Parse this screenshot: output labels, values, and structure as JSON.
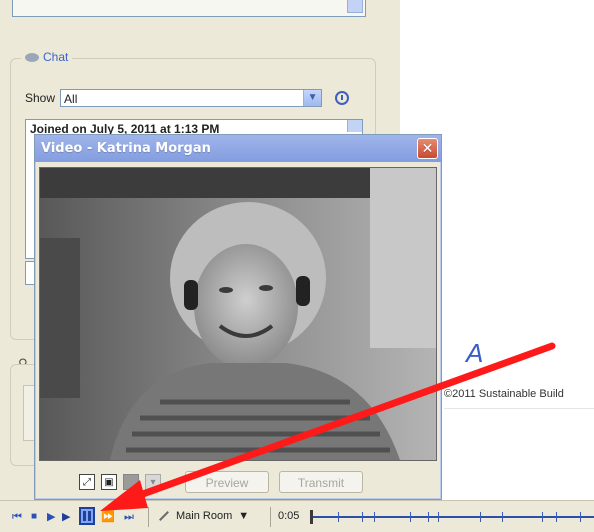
{
  "chat": {
    "legend": "Chat",
    "show_label": "Show",
    "show_value": "All",
    "log_text": "Joined on July 5, 2011 at 1:13 PM"
  },
  "video_window": {
    "title": "Video - Katrina Morgan",
    "close_glyph": "✕",
    "preview_label": "Preview",
    "transmit_label": "Transmit"
  },
  "content": {
    "copyright": "©2011 Sustainable Build"
  },
  "playbar": {
    "room_label": "Main Room",
    "room_arrow": "▼",
    "time": "0:05",
    "icons": [
      "skip-to-start-icon",
      "stop-icon",
      "play-icon",
      "pause-icon",
      "fast-forward-icon",
      "skip-to-end-icon"
    ]
  },
  "colors": {
    "title_bar": "#8aa3e3",
    "annotation_arrow": "#ff1a1a",
    "accent": "#2b50b8"
  }
}
